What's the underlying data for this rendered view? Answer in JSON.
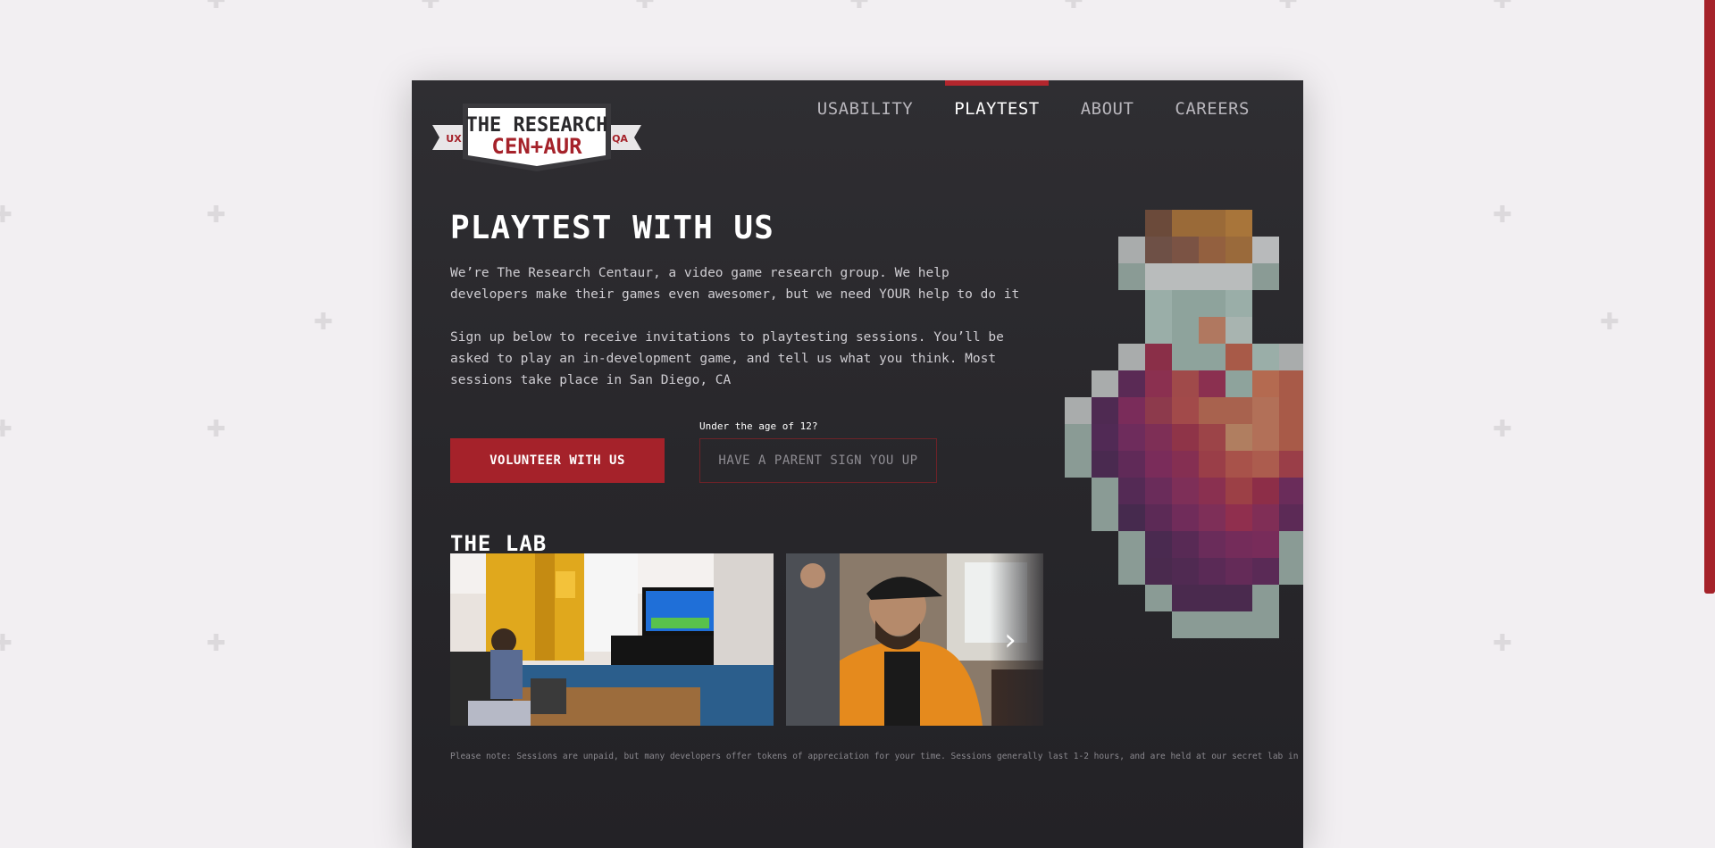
{
  "nav": {
    "items": [
      {
        "label": "USABILITY",
        "active": false
      },
      {
        "label": "PLAYTEST",
        "active": true
      },
      {
        "label": "ABOUT",
        "active": false
      },
      {
        "label": "CAREERS",
        "active": false
      }
    ]
  },
  "logo": {
    "line1": "THE RESEARCH",
    "line2": "CEN+AUR",
    "left_tag": "UX",
    "right_tag": "QA"
  },
  "hero": {
    "title": "PLAYTEST WITH US",
    "intro": "We’re The Research Centaur, a video game research group. We help developers make their games even awesomer, but we need YOUR help to do it",
    "signup": "Sign up below to receive invitations to playtesting sessions. You’ll be asked to play an in-development game, and tell us what you think. Most sessions take place in San Diego, CA"
  },
  "actions": {
    "volunteer_label": "VOLUNTEER WITH US",
    "age_note": "Under the age of 12?",
    "parent_label": "HAVE A PARENT SIGN YOU UP"
  },
  "lab": {
    "title": "THE LAB",
    "next_icon": "chevron-right-icon"
  },
  "footnote": "Please note: Sessions are unpaid, but many developers offer tokens of appreciation for your time. Sessions generally last 1-2 hours, and are held at our secret lab in San Diego",
  "colors": {
    "accent": "#a5222a",
    "card_bg": "#2b2a2e",
    "page_bg": "#f2eff2"
  }
}
